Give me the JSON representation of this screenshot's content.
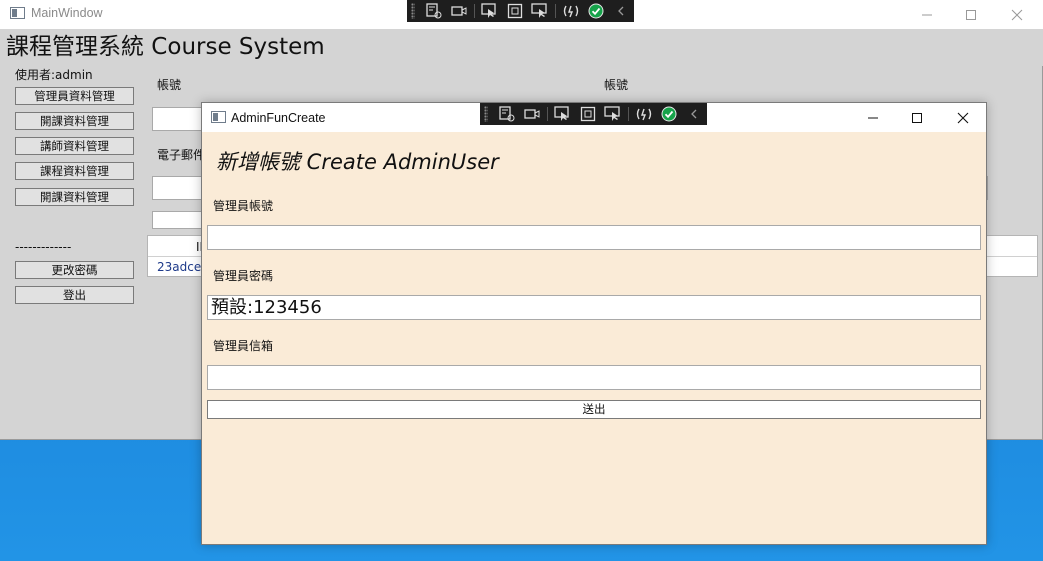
{
  "main_window": {
    "title": "MainWindow",
    "app_header": "課程管理系統 Course System",
    "user_label": "使用者:admin",
    "nav_items": [
      "管理員資料管理",
      "開課資料管理",
      "講師資料管理",
      "課程資料管理",
      "開課資料管理"
    ],
    "divider": "-------------",
    "change_password": "更改密碼",
    "logout": "登出",
    "content": {
      "account_label_left": "帳號",
      "account_label_right": "帳號",
      "email_label": "電子郵件",
      "grid_header_partial": "ID",
      "grid_first_cell": "23adce4"
    }
  },
  "dialog": {
    "title": "AdminFunCreate",
    "heading": "新增帳號 Create AdminUser",
    "account_label": "管理員帳號",
    "account_value": "",
    "password_label": "管理員密碼",
    "password_value": "預設:123456",
    "email_label": "管理員信箱",
    "email_value": "",
    "submit_label": "送出"
  },
  "caption_icons": [
    "minimize-icon",
    "maximize-icon",
    "close-icon"
  ],
  "debug_toolbar_icons": [
    "live-visual-tree-icon",
    "record-icon",
    "select-element-icon",
    "display-layout-adorners-icon",
    "track-focus-icon",
    "hot-reload-icon",
    "binding-check-icon",
    "collapse-chevron-icon"
  ],
  "colors": {
    "main_background": "#d4d4d4",
    "dialog_background": "#faebd7",
    "desktop": "#1b86dc",
    "toolbar": "#1e1e1e",
    "check_green": "#16a34a"
  }
}
